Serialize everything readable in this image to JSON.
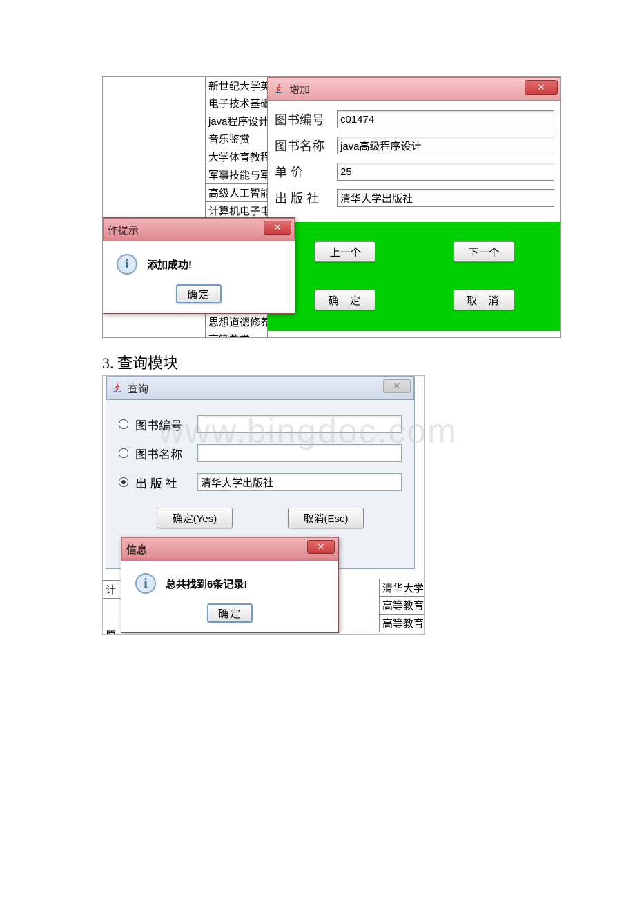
{
  "doc": {
    "section_heading": "3. 查询模块"
  },
  "watermark": "www.bingdoc.com",
  "bg_list": {
    "items": [
      "新世纪大学英语",
      "电子技术基础",
      "java程序设计",
      "音乐鉴赏",
      "大学体育教程",
      "军事技能与军事",
      "高级人工智能",
      "计算机电子电路",
      "思想道德修养与",
      "高等数学"
    ]
  },
  "add_window": {
    "title": "增加",
    "fields": {
      "book_id_label": "图书编号",
      "book_id_value": "c01474",
      "book_name_label": "图书名称",
      "book_name_value": "java高级程序设计",
      "price_label": "单      价",
      "price_value": "25",
      "publisher_label": "出 版 社",
      "publisher_value": "清华大学出版社"
    },
    "buttons": {
      "prev": "上一个",
      "next": "下一个",
      "ok": "确 定",
      "cancel": "取 消"
    }
  },
  "prompt_dialog": {
    "title": "作提示",
    "message": "添加成功!",
    "ok": "确定"
  },
  "query_window": {
    "title": "查询",
    "options": {
      "book_id_label": "图书编号",
      "book_name_label": "图书名称",
      "publisher_label": "出 版 社",
      "publisher_value": "清华大学出版社"
    },
    "buttons": {
      "ok": "确定(Yes)",
      "cancel": "取消(Esc)"
    }
  },
  "info_dialog": {
    "title": "信息",
    "message": "总共找到6条记录!",
    "ok": "确定"
  },
  "bottom_left": {
    "c1": "计",
    "c2": "原理"
  },
  "bottom_right": {
    "r1": "清华大学",
    "r2": "高等教育",
    "r3": "高等教育"
  }
}
